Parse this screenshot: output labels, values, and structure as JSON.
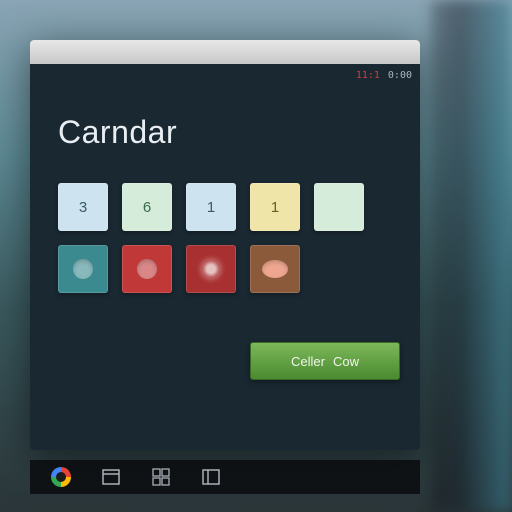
{
  "titlebar": {
    "left": "",
    "right": ""
  },
  "status": {
    "code": "11:1",
    "clock": "0:00"
  },
  "app": {
    "title": "Carndar"
  },
  "grid": {
    "row1": [
      {
        "label": "3",
        "variant": "blue"
      },
      {
        "label": "6",
        "variant": "mint"
      },
      {
        "label": "1",
        "variant": "blue"
      },
      {
        "label": "1",
        "variant": "yellow"
      },
      {
        "label": "",
        "variant": "mint"
      }
    ],
    "row2": [
      {
        "icon": "circle",
        "variant": "teal"
      },
      {
        "icon": "circle",
        "variant": "red"
      },
      {
        "icon": "flower",
        "variant": "red2"
      },
      {
        "icon": "oval",
        "variant": "brown"
      }
    ]
  },
  "action": {
    "primary": "Celler",
    "secondary": "Cow"
  },
  "taskbar": {
    "items": [
      "chrome",
      "app1",
      "app2",
      "app3"
    ]
  }
}
